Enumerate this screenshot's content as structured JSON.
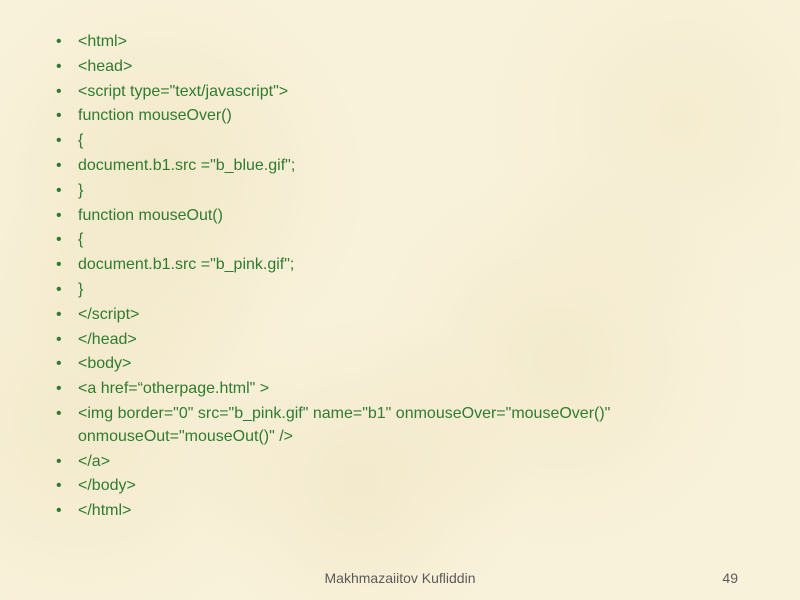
{
  "lines": [
    "<html>",
    " <head>",
    " <script type=\"text/javascript\">",
    " function mouseOver()",
    "{",
    "document.b1.src =\"b_blue.gif\";",
    " }",
    " function mouseOut()",
    "{",
    "document.b1.src =\"b_pink.gif\";",
    " }",
    "</script>",
    "</head>",
    " <body>",
    "<a href=“otherpage.html\" >",
    " <img border=\"0\" src=\"b_pink.gif\" name=\"b1\" onmouseOver=\"mouseOver()\"",
    "onmouseOut=\"mouseOut()\" />",
    " </a>",
    "</body>",
    "</html>"
  ],
  "wrap_indices": [
    16
  ],
  "footer_author": "Makhmazaiitov Kufliddin",
  "page_number": "49"
}
